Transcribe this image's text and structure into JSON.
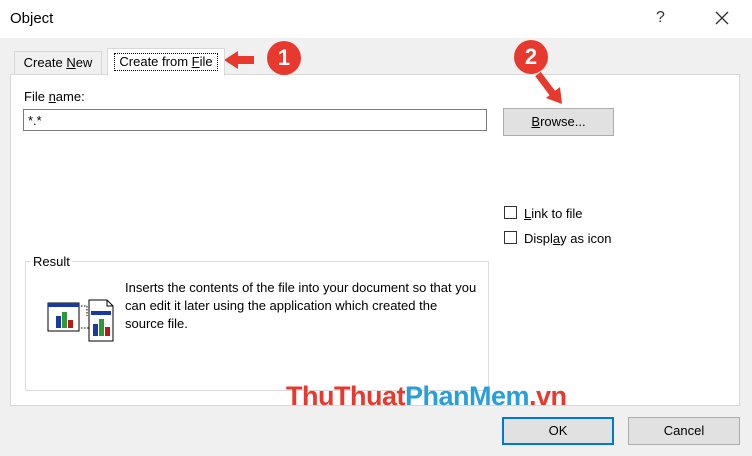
{
  "window": {
    "title": "Object",
    "help_label": "?"
  },
  "tabs": [
    {
      "label_pre": "Create ",
      "label_acc": "N",
      "label_post": "ew"
    },
    {
      "label_pre": "Create from ",
      "label_acc": "F",
      "label_post": "ile"
    }
  ],
  "file_name": {
    "label_pre": "File ",
    "label_acc": "n",
    "label_post": "ame:",
    "value": "*.*"
  },
  "browse": {
    "label_acc": "B",
    "label_post": "rowse..."
  },
  "link_to_file": {
    "label_pre": "",
    "label_acc": "L",
    "label_post": "ink to file",
    "checked": false
  },
  "display_as_icon": {
    "label_pre": "Displ",
    "label_acc": "a",
    "label_post": "y as icon",
    "checked": false
  },
  "result": {
    "label": "Result",
    "text": "Inserts the contents of the file into your document so that you can edit it later using the application which created the source file."
  },
  "buttons": {
    "ok": "OK",
    "cancel": "Cancel"
  },
  "annotations": {
    "step1": "1",
    "step2": "2",
    "color": "#e8392e"
  },
  "watermark": {
    "part1": "ThuThuat",
    "part2": "PhanMem",
    "part3": ".vn"
  }
}
